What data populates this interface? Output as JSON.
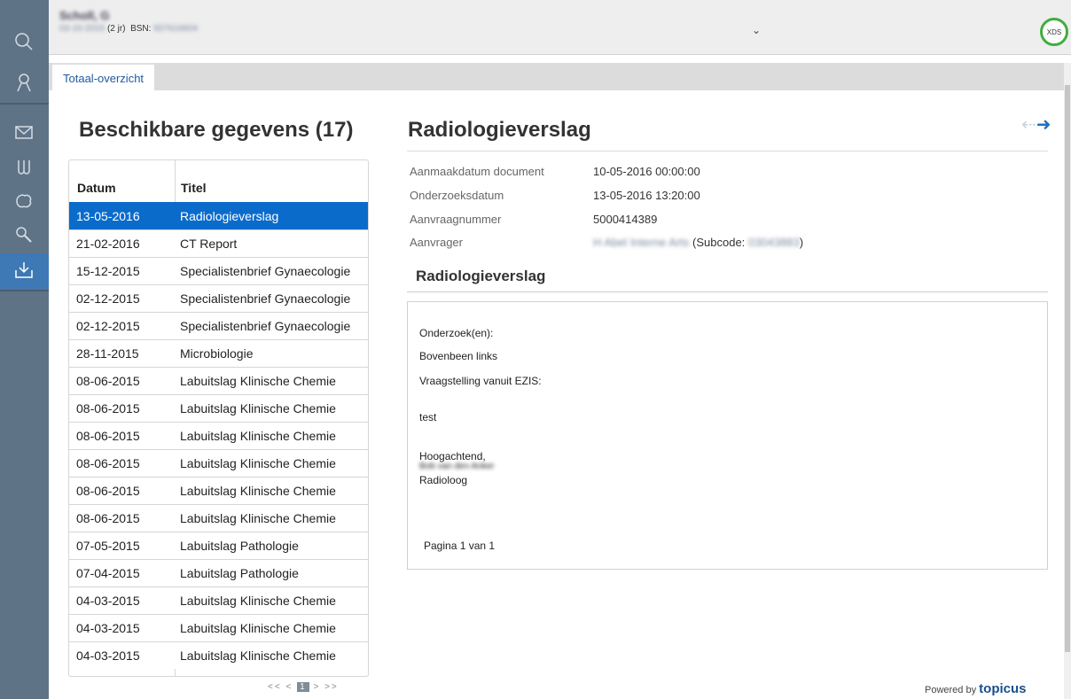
{
  "patient": {
    "name": "Scholl, G",
    "dob": "03-10-2015",
    "age": "(2 jr)",
    "bsn_label": "BSN:",
    "bsn": "507616604",
    "badge": "XDS"
  },
  "tabs": [
    {
      "label": "Totaal-overzicht"
    }
  ],
  "list": {
    "title": "Beschikbare gegevens (17)",
    "headers": {
      "date": "Datum",
      "title": "Titel"
    },
    "rows": [
      {
        "date": "13-05-2016",
        "title": "Radiologieverslag"
      },
      {
        "date": "21-02-2016",
        "title": "CT Report"
      },
      {
        "date": "15-12-2015",
        "title": "Specialistenbrief Gynaecologie"
      },
      {
        "date": "02-12-2015",
        "title": "Specialistenbrief Gynaecologie"
      },
      {
        "date": "02-12-2015",
        "title": "Specialistenbrief Gynaecologie"
      },
      {
        "date": "28-11-2015",
        "title": "Microbiologie"
      },
      {
        "date": "08-06-2015",
        "title": "Labuitslag Klinische Chemie"
      },
      {
        "date": "08-06-2015",
        "title": "Labuitslag Klinische Chemie"
      },
      {
        "date": "08-06-2015",
        "title": "Labuitslag Klinische Chemie"
      },
      {
        "date": "08-06-2015",
        "title": "Labuitslag Klinische Chemie"
      },
      {
        "date": "08-06-2015",
        "title": "Labuitslag Klinische Chemie"
      },
      {
        "date": "08-06-2015",
        "title": "Labuitslag Klinische Chemie"
      },
      {
        "date": "07-05-2015",
        "title": "Labuitslag Pathologie"
      },
      {
        "date": "07-04-2015",
        "title": "Labuitslag Pathologie"
      },
      {
        "date": "04-03-2015",
        "title": "Labuitslag Klinische Chemie"
      },
      {
        "date": "04-03-2015",
        "title": "Labuitslag Klinische Chemie"
      },
      {
        "date": "04-03-2015",
        "title": "Labuitslag Klinische Chemie"
      }
    ],
    "pager": {
      "first": "<<",
      "prev": "<",
      "current": "1",
      "next": ">",
      "last": ">>"
    }
  },
  "detail": {
    "title": "Radiologieverslag",
    "fields": [
      {
        "label": "Aanmaakdatum document",
        "value": "10-05-2016 00:00:00"
      },
      {
        "label": "Onderzoeksdatum",
        "value": "13-05-2016 13:20:00"
      },
      {
        "label": "Aanvraagnummer",
        "value": "5000414389"
      },
      {
        "label": "Aanvrager",
        "value_blurred": "H Abel Interne Arts",
        "value_mid": "(Subcode:",
        "value_code": "03043883",
        "value_end": ")"
      }
    ],
    "section_title": "Radiologieverslag",
    "document": {
      "lines": [
        "Onderzoek(en):",
        "Bovenbeen links",
        "Vraagstelling vanuit EZIS:",
        "test",
        "Hoogachtend,",
        "Bob van den Anker",
        "Radioloog",
        "Pagina 1 van 1"
      ]
    }
  },
  "footer": {
    "powered_prefix": "Powered by",
    "brand": "topicus"
  },
  "colors": {
    "sidebar": "#5f7387",
    "selected": "#0b6bcb",
    "accent_green": "#3fae3f"
  }
}
